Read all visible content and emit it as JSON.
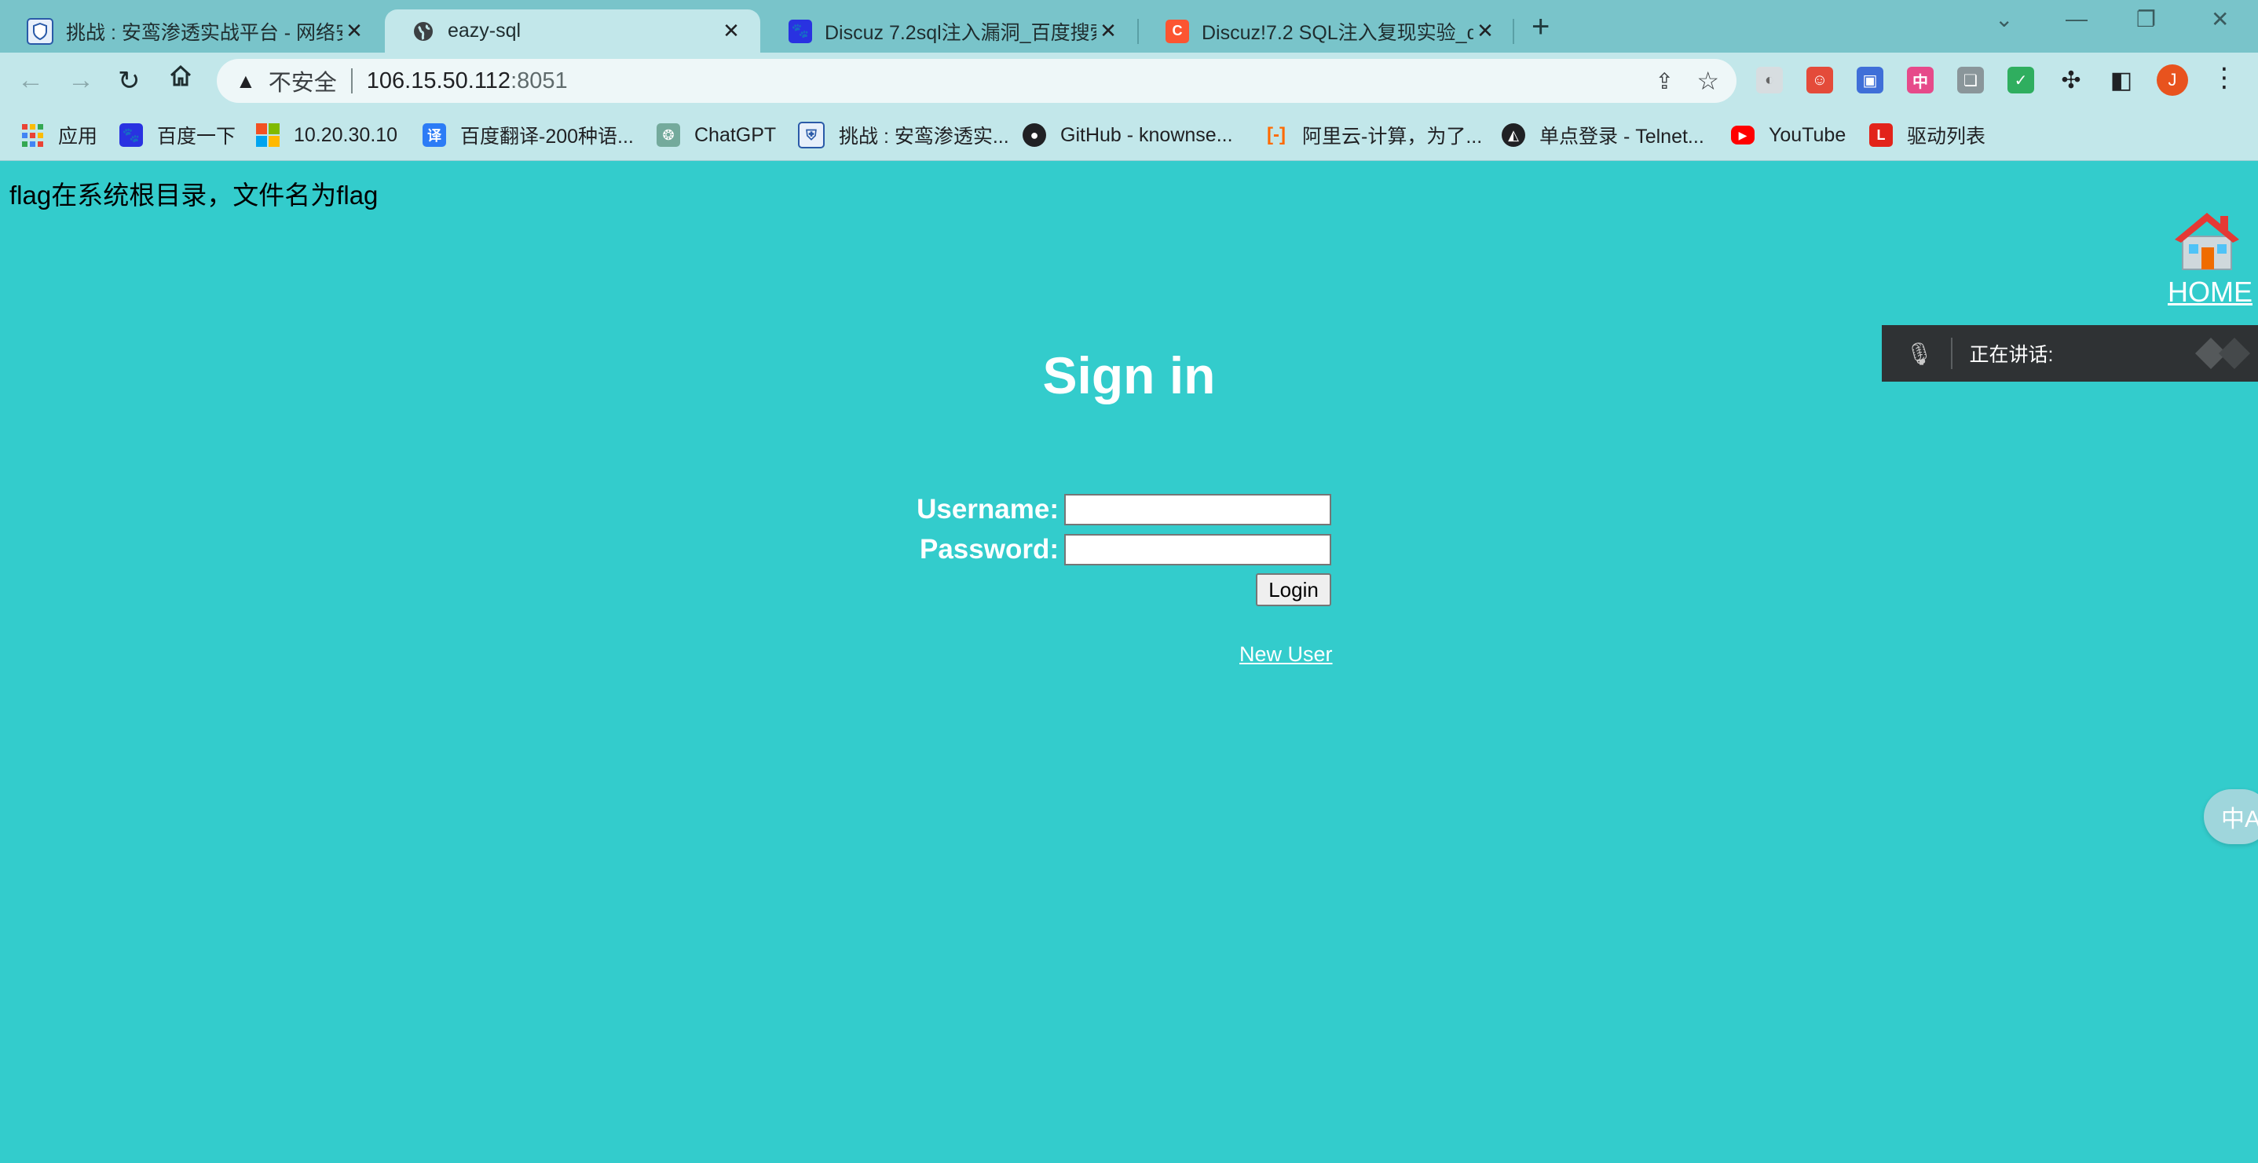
{
  "tabs": [
    {
      "title": "挑战 : 安鸾渗透实战平台 - 网络安",
      "icon": "shield-favicon"
    },
    {
      "title": "eazy-sql",
      "icon": "globe-favicon"
    },
    {
      "title": "Discuz 7.2sql注入漏洞_百度搜索",
      "icon": "baidu-favicon"
    },
    {
      "title": "Discuz!7.2 SQL注入复现实验_di",
      "icon": "csdn-favicon"
    }
  ],
  "address_bar": {
    "security_label": "不安全",
    "host": "106.15.50.112",
    "port": ":8051"
  },
  "bookmarks": [
    {
      "label": "应用",
      "icon": "apps-grid-icon"
    },
    {
      "label": "百度一下",
      "icon": "baidu-icon"
    },
    {
      "label": "10.20.30.10",
      "icon": "windows-icon"
    },
    {
      "label": "百度翻译-200种语...",
      "icon": "translate-icon"
    },
    {
      "label": "ChatGPT",
      "icon": "openai-icon"
    },
    {
      "label": "挑战 : 安鸾渗透实...",
      "icon": "shield-icon"
    },
    {
      "label": "GitHub - knownse...",
      "icon": "github-icon"
    },
    {
      "label": "阿里云-计算，为了...",
      "icon": "aliyun-icon"
    },
    {
      "label": "单点登录 - Telnet...",
      "icon": "telnet-icon"
    },
    {
      "label": "YouTube",
      "icon": "youtube-icon"
    },
    {
      "label": "驱动列表",
      "icon": "lenovo-icon"
    }
  ],
  "profile_initial": "J",
  "page": {
    "hint": "flag在系统根目录，文件名为flag",
    "home_label": "HOME",
    "title": "Sign in",
    "username_label": "Username:",
    "password_label": "Password:",
    "username_value": "",
    "password_value": "",
    "login_label": "Login",
    "new_user_label": "New User"
  },
  "voice_overlay": {
    "text": "正在讲话:"
  },
  "translate_fab": {
    "text": "中A"
  },
  "colors": {
    "page_background": "#33cccc",
    "tab_strip": "#79c4ca",
    "toolbar": "#c2e7ea"
  }
}
